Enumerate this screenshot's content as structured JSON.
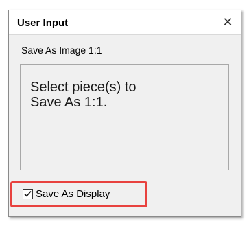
{
  "window": {
    "title": "User Input",
    "close_glyph": "✕"
  },
  "dialog": {
    "subtitle": "Save As Image 1:1",
    "message_line1": "Select piece(s) to",
    "message_line2": "Save As 1:1."
  },
  "option": {
    "checkbox_label": "Save As Display",
    "checked": true
  },
  "colors": {
    "highlight": "#e8423f",
    "dialog_bg": "#f0f0f0"
  },
  "icons": {
    "close": "close-icon",
    "check": "checkmark-icon"
  }
}
